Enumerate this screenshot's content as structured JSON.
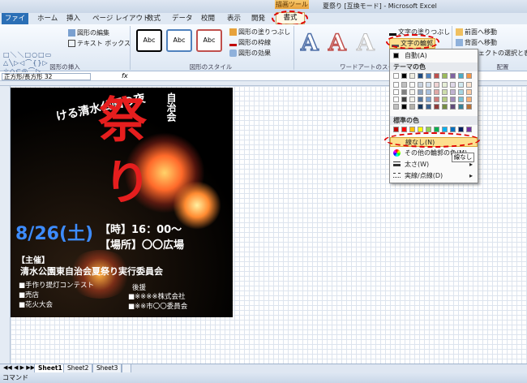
{
  "window": {
    "title": "夏祭り [互換モード] - Microsoft Excel",
    "context_tab_group": "描画ツール"
  },
  "ribbon_tabs": {
    "file": "ファイル",
    "items": [
      "ホーム",
      "挿入",
      "ページ レイアウト",
      "数式",
      "データ",
      "校閲",
      "表示",
      "開発"
    ],
    "format": "書式"
  },
  "ribbon": {
    "insert_shapes_group": "図形の挿入",
    "edit_shape": "図形の編集",
    "text_box": "テキスト ボックス",
    "style_sample": "Abc",
    "shape_styles_group": "図形のスタイル",
    "shape_fill": "図形の塗りつぶし",
    "shape_outline": "図形の枠線",
    "shape_effects": "図形の効果",
    "wordart_group": "ワードアートのスタイル",
    "wordart_sample": "A",
    "text_fill": "文字の塗りつぶし",
    "text_outline": "文字の輪郭",
    "bring_forward": "前面へ移動",
    "send_backward": "背面へ移動",
    "selection_pane": "ェクトの選択と表示",
    "arrange_group": "配置"
  },
  "formula_bar": {
    "name_box": "正方形/長方形 32",
    "fx": "fx"
  },
  "poster": {
    "top_text": "自治会",
    "title_char1": "祭",
    "title_char2": "り",
    "subtitle": "ける清水公園の夜",
    "date": "8/26(土)",
    "time_line": "【時】16：00～",
    "place_line": "【場所】〇〇広場",
    "organizer_label": "【主催】",
    "organizer": "清水公園東自治会夏祭り実行委員会",
    "events": [
      "■手作り提灯コンテスト",
      "■売店",
      "■花火大会"
    ],
    "sponsor_label": "後援",
    "sponsors": [
      "■※※※※株式会社",
      "■※※市〇〇委員会"
    ]
  },
  "dropdown": {
    "auto": "自動(A)",
    "theme_colors": "テーマの色",
    "standard_colors": "標準の色",
    "no_outline": "線なし(N)",
    "more_colors": "その他の輪郭の色(M)...",
    "weight": "太さ(W)",
    "dashes": "実線/点線(D)",
    "theme_palette": [
      "#ffffff",
      "#000000",
      "#eeece1",
      "#1f497d",
      "#4f81bd",
      "#c0504d",
      "#9bbb59",
      "#8064a2",
      "#4bacc6",
      "#f79646"
    ],
    "standard_palette": [
      "#c00000",
      "#ff0000",
      "#ffc000",
      "#ffff00",
      "#92d050",
      "#00b050",
      "#00b0f0",
      "#0070c0",
      "#002060",
      "#7030a0"
    ]
  },
  "tooltip": "線なし",
  "sheets": [
    "Sheet1",
    "Sheet2",
    "Sheet3"
  ],
  "status": "コマンド"
}
